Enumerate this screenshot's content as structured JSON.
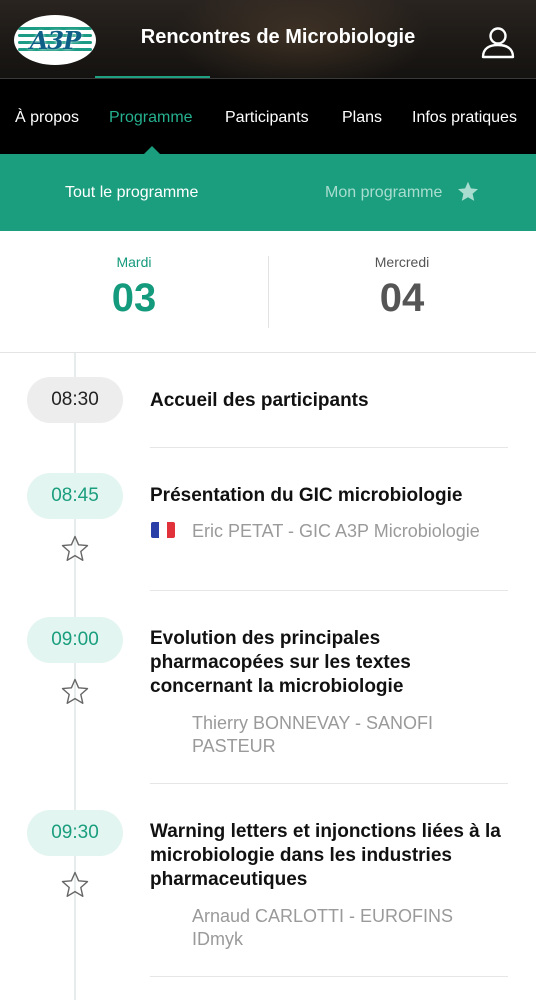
{
  "header": {
    "logo_text": "A3P",
    "title": "Rencontres de Microbiologie",
    "user_icon": "user-icon"
  },
  "nav": {
    "items": [
      {
        "label": "À propos",
        "active": false
      },
      {
        "label": "Programme",
        "active": true
      },
      {
        "label": "Participants",
        "active": false
      },
      {
        "label": "Plans",
        "active": false
      },
      {
        "label": "Infos pratiques",
        "active": false
      }
    ]
  },
  "subtabs": {
    "all": "Tout le programme",
    "mine": "Mon programme",
    "mine_icon": "star-icon"
  },
  "days": [
    {
      "name": "Mardi",
      "number": "03",
      "active": true
    },
    {
      "name": "Mercredi",
      "number": "04",
      "active": false
    }
  ],
  "sessions": [
    {
      "time": "08:30",
      "title": "Accueil des participants",
      "speaker": "",
      "flag": ""
    },
    {
      "time": "08:45",
      "title": "Présentation du GIC microbiologie",
      "speaker": "Eric PETAT - GIC A3P Microbiologie",
      "flag": "fr"
    },
    {
      "time": "09:00",
      "title": "Evolution des principales pharmacopées sur les textes concernant la microbiologie",
      "speaker": "Thierry BONNEVAY - SANOFI PASTEUR",
      "flag": ""
    },
    {
      "time": "09:30",
      "title": "Warning letters et injonctions liées à la microbiologie dans les industries pharmaceutiques",
      "speaker": "Arnaud CARLOTTI - EUROFINS IDmyk",
      "flag": ""
    }
  ],
  "colors": {
    "accent": "#1a9e7e",
    "nav_bg": "#000000",
    "active_text": "#25b08f"
  }
}
